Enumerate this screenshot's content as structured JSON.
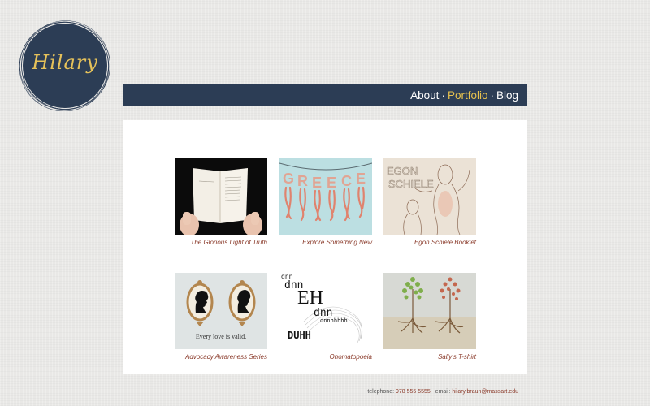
{
  "logo": {
    "text": "Hilary"
  },
  "nav": {
    "items": [
      {
        "label": "About",
        "active": false
      },
      {
        "label": "Portfolio",
        "active": true
      },
      {
        "label": "Blog",
        "active": false
      }
    ],
    "separator": "·"
  },
  "portfolio": {
    "items": [
      {
        "caption": "The  Glorious Light of Truth",
        "image": "open-book-photo"
      },
      {
        "caption": "Explore Something New",
        "image": "greece-octopus-illustration"
      },
      {
        "caption": "Egon Schiele Booklet",
        "image": "egon-schiele-sketch"
      },
      {
        "caption": "Advocacy Awareness Series",
        "image": "silhouette-frames-poster",
        "poster_text": "Every love is valid."
      },
      {
        "caption": "Onomatopoeia",
        "image": "typography-artwork",
        "words": [
          "dnn",
          "dnn",
          "EH",
          "dnn",
          "dnnhhhhh",
          "DUHH"
        ]
      },
      {
        "caption": "Sally's T-shirt",
        "image": "trees-with-roots-illustration"
      }
    ]
  },
  "footer": {
    "telephone_label": "telephone:",
    "telephone": "978 555 5555",
    "email_label": "email:",
    "email": "hilary.braun@massart.edu"
  },
  "colors": {
    "navbar": "#2c3d55",
    "nav_active": "#e8c34e",
    "caption": "#8a3a2a",
    "logo_fill": "#2c3d55",
    "logo_text": "#e6c25a"
  }
}
